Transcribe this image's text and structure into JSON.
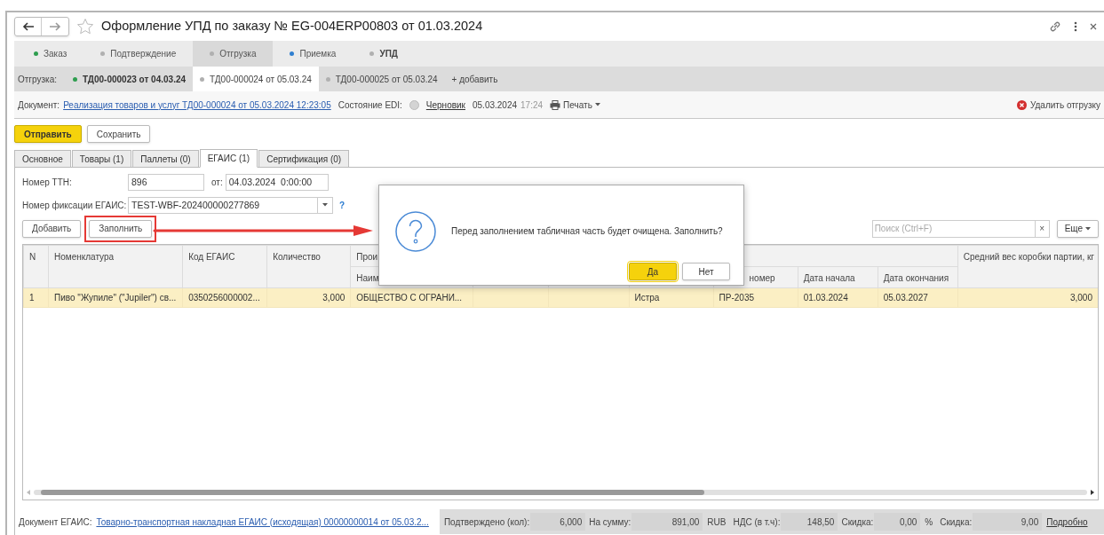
{
  "window": {
    "title": "Оформление УПД по заказу № EG-004ERP00803 от 01.03.2024",
    "favorite": false
  },
  "stage_tabs": [
    {
      "label": "Заказ",
      "color": "#2e9e4f",
      "selected": false,
      "emphasized": false
    },
    {
      "label": "Подтверждение",
      "color": "#b0b0b0",
      "selected": false,
      "emphasized": false
    },
    {
      "label": "Отгрузка",
      "color": "#b0b0b0",
      "selected": true,
      "emphasized": false
    },
    {
      "label": "Приемка",
      "color": "#2f7fd0",
      "selected": false,
      "emphasized": false
    },
    {
      "label": "УПД",
      "color": "#b0b0b0",
      "selected": false,
      "emphasized": true
    }
  ],
  "shipment_bar": {
    "label": "Отгрузка:",
    "tabs": [
      {
        "label": "ТД00-000023 от 04.03.24",
        "color": "#2e9e4f",
        "selected": false,
        "emphasized": true
      },
      {
        "label": "ТД00-000024 от 05.03.24",
        "color": "#b0b0b0",
        "selected": true,
        "emphasized": false
      },
      {
        "label": "ТД00-000025 от 05.03.24",
        "color": "#b0b0b0",
        "selected": false,
        "emphasized": false
      }
    ],
    "add": "+ добавить"
  },
  "document_bar": {
    "label": "Документ:",
    "link": "Реализация товаров и услуг ТД00-000024 от 05.03.2024 12:23:05",
    "state_label": "Состояние EDI:",
    "state_value": "Черновик",
    "date": "05.03.2024",
    "time": "17:24",
    "print": "Печать",
    "delete": "Удалить отгрузку"
  },
  "actions": [
    {
      "label": "Отправить",
      "kind": "primary"
    },
    {
      "label": "Сохранить",
      "kind": "default"
    }
  ],
  "form_tabs": [
    {
      "label": "Основное",
      "selected": false
    },
    {
      "label": "Товары (1)",
      "selected": false
    },
    {
      "label": "Паллеты (0)",
      "selected": false
    },
    {
      "label": "ЕГАИС (1)",
      "selected": true
    },
    {
      "label": "Сертификация (0)",
      "selected": false
    }
  ],
  "fields": {
    "ttn_label": "Номер ТТН:",
    "ttn_value": "896",
    "date_label": "от:",
    "date_value": "04.03.2024  0:00:00",
    "egais_label": "Номер фиксации ЕГАИС:",
    "egais_value": "TEST-WBF-202400000277869",
    "help": "?"
  },
  "table_toolbar": {
    "buttons": [
      {
        "label": "Добавить",
        "highlighted": false
      },
      {
        "label": "Заполнить",
        "highlighted": true
      }
    ],
    "search_placeholder": "Поиск (Ctrl+F)",
    "clear": "×",
    "more": "Еще"
  },
  "table": {
    "columns": [
      {
        "label": "N"
      },
      {
        "label": "Номенклатура"
      },
      {
        "label": "Код ЕГАИС"
      },
      {
        "label": "Количество"
      },
      {
        "label": "Прои",
        "subcolumns": [
          "Наим",
          null,
          null,
          null,
          "номер",
          "Дата начала",
          "Дата окончания"
        ]
      },
      {
        "label": "Средний вес коробки партии, кг"
      }
    ],
    "rows": [
      {
        "selected": true,
        "cells": [
          "1",
          "Пиво \"Жупиле\" (\"Jupiler\") св...",
          "0350256000002...",
          "3,000",
          "ОБЩЕСТВО С ОГРАНИ...",
          null,
          null,
          "Истра",
          "ПР-2035",
          "01.03.2024",
          "05.03.2027",
          "3,000"
        ]
      }
    ]
  },
  "dialog": {
    "message": "Перед заполнением табличная часть будет очищена. Заполнить?",
    "buttons": [
      {
        "label": "Да",
        "kind": "primary"
      },
      {
        "label": "Нет",
        "kind": "default"
      }
    ]
  },
  "footer": {
    "egais_label": "Документ ЕГАИС:",
    "egais_link": "Товарно-транспортная накладная ЕГАИС (исходящая) 00000000014 от 05.03.2...",
    "totals": [
      {
        "label": "Подтверждено (кол):",
        "value": "6,000"
      },
      {
        "label": "На сумму:",
        "value": "891,00",
        "unit": "RUB"
      },
      {
        "label": "НДС (в т.ч):",
        "value": "148,50"
      },
      {
        "label": "Скидка:",
        "value": "0,00",
        "unit": "%"
      },
      {
        "label": "Скидка:",
        "value": "9,00"
      }
    ],
    "details": "Подробно"
  }
}
